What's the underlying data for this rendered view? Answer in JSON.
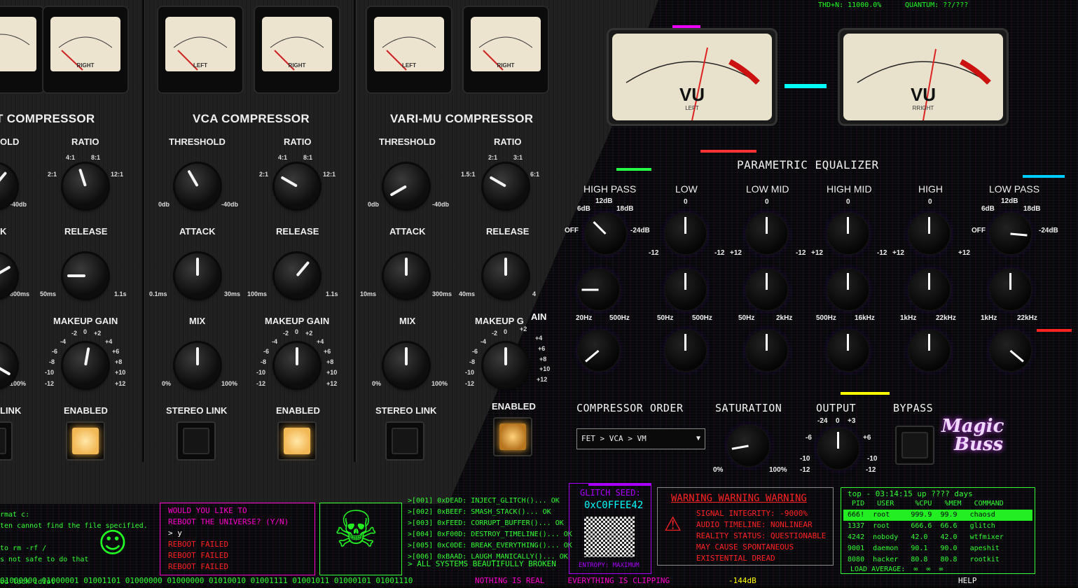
{
  "sections": {
    "fet": {
      "title": "FET COMPRESSOR",
      "title_visible": "T COMPRESSOR",
      "threshold_partial": "OLD",
      "ratio": "RATIO",
      "ratio_ticks": [
        "4:1",
        "8:1",
        "2:1",
        "12:1"
      ],
      "thr_tick": "-40db",
      "attack_partial": "K",
      "release": "RELEASE",
      "rel_ticks": [
        "50ms",
        "1.1s"
      ],
      "atk_tick": "800ms",
      "makeup": "MAKEUP GAIN",
      "mix_tick": "100%",
      "link_partial": "LINK",
      "enabled": "ENABLED",
      "meter_right": "RIGHT"
    },
    "vca": {
      "title": "VCA COMPRESSOR",
      "threshold": "THRESHOLD",
      "ratio": "RATIO",
      "thr_ticks": [
        "0db",
        "-40db"
      ],
      "ratio_ticks": [
        "4:1",
        "8:1",
        "2:1",
        "12:1"
      ],
      "attack": "ATTACK",
      "release": "RELEASE",
      "atk_ticks": [
        "0.1ms",
        "30ms"
      ],
      "rel_ticks": [
        "100ms",
        "1.1s"
      ],
      "mix": "MIX",
      "makeup": "MAKEUP GAIN",
      "mix_ticks": [
        "0%",
        "100%"
      ],
      "stereo_link": "STEREO LINK",
      "enabled": "ENABLED",
      "meter_left": "LEFT",
      "meter_right": "RIGHT"
    },
    "varimu": {
      "title": "VARI-MU COMPRESSOR",
      "threshold": "THRESHOLD",
      "ratio": "RATIO",
      "thr_ticks": [
        "0db",
        "-40db"
      ],
      "ratio_ticks": [
        "2:1",
        "3:1",
        "1.5:1",
        "6:1"
      ],
      "attack": "ATTACK",
      "release": "RELEASE",
      "atk_ticks": [
        "10ms",
        "300ms"
      ],
      "rel_ticks": [
        "40ms",
        "4"
      ],
      "mix": "MIX",
      "makeup": "MAKEUP G",
      "makeup_glitch": "AIN",
      "mix_ticks": [
        "0%",
        "100%"
      ],
      "stereo_link": "STEREO LINK",
      "enabled": "ENABLED",
      "meter_left": "LEFT",
      "meter_right": "RIGHT"
    }
  },
  "gain_ticks": [
    "-2",
    "0",
    "+2",
    "-4",
    "+4",
    "-6",
    "+6",
    "-8",
    "+8",
    "-10",
    "+10",
    "-12",
    "+12"
  ],
  "meter_ticks": [
    "0",
    "3",
    "6",
    "9",
    "12",
    "15"
  ],
  "vu": {
    "label": "VU",
    "left": "LEFT",
    "right": "RRIGHT",
    "scale": [
      "-20",
      "-10",
      "-5",
      "-3",
      "0",
      "+1",
      "+2",
      "+3",
      "20",
      "40",
      "60",
      "80",
      "100"
    ]
  },
  "top_glitch": {
    "thd": "THD+N: 11000.0%",
    "quantum": "QUANTUM: ??/???"
  },
  "eq": {
    "title": "PARAMETRIC EQUALIZER",
    "bands": [
      "HIGH PASS",
      "LOW",
      "LOW MID",
      "HIGH MID",
      "HIGH",
      "LOW PASS"
    ],
    "pass_ticks": [
      "6dB",
      "12dB",
      "18dB",
      "OFF",
      "-24dB"
    ],
    "gain_ticks": [
      "0",
      "-12",
      "+12"
    ],
    "freq_ticks": [
      [
        "20Hz",
        "500Hz"
      ],
      [
        "50Hz",
        "500Hz"
      ],
      [
        "50Hz",
        "2kHz"
      ],
      [
        "500Hz",
        "16kHz"
      ],
      [
        "1kHz",
        "22kHz"
      ],
      [
        "1kHz",
        "22kHz"
      ]
    ]
  },
  "controls": {
    "compressor_order": "COMPRESSOR ORDER",
    "order_value": "FET > VCA > VM",
    "saturation": "SATURATION",
    "sat_ticks": [
      "0%",
      "100%"
    ],
    "output": "OUTPUT",
    "out_ticks": [
      "-24",
      "0",
      "+3",
      "-6",
      "+6",
      "-10",
      "-12"
    ],
    "bypass": "BYPASS",
    "enabled": "ENABLED"
  },
  "logo": {
    "line1": "Magic",
    "line2": "Buss"
  },
  "terminal": {
    "cmd": "rmat c:\nten cannot find the file specified.\n\nto rm -rf /\ns not safe to do that\n\nod luck idiot",
    "reboot_q": "WOULD YOU LIKE TO\nREBOOT THE UNIVERSE? (Y/N)",
    "reboot_a": "> y",
    "reboot_f": "REBOOT FAILED\nREBOOT FAILED\nREBOOT FAILED",
    "log": ">[001] 0xDEAD: INJECT_GLITCH()... OK\n>[002] 0xBEEF: SMASH_STACK()... OK\n>[003] 0xFEED: CORRUPT_BUFFER()... OK\n>[004] 0xF00D: DESTROY_TIMELINE()... OK\n>[005] 0xC0DE: BREAK_EVERYTHING()... OK\n>[006] 0xBAAD: LAUGH_MANICALLY()... OK",
    "log_end": "> ALL SYSTEMS BEAUTIFULLY BROKEN",
    "seed_title": "GLITCH SEED:",
    "seed": "0xC0FFEE42",
    "entropy": "ENTROPY: MAXIMUM",
    "warning_title": "WARNING WARNING WARNING",
    "warning_lines": "SIGNAL INTEGRITY: -9000%\nAUDIO TIMELINE: NONLINEAR\nREALITY STATUS: QUESTIONABLE\nMAY CAUSE SPONTANEOUS\nEXISTENTIAL DREAD",
    "top_head": "top - 03:14:15 up ???? days",
    "top_cols": "  PID   USER     %CPU   %MEM   COMMAND",
    "top_row1": " 666!  root     999.9  99.9   chaosd",
    "top_rows": " 1337  root     666.6  66.6   glitch\n 4242  nobody   42.0   42.0   wtfmixer\n 9001  daemon   90.1   90.0   apeshit\n 8080  hacker   80.8   80.8   rootkit",
    "load": "LOAD AVERAGE:  ∞  ∞  ∞",
    "binary": "01000000 01000001 01001101 01000000 01000000 01010010 01001111 01001011 01000101 01001110",
    "bottom_msg": "NOTHING IS REAL     EVERYTHING IS CLIPPING",
    "bottom_db": "-144dB",
    "bottom_help": "HELP"
  }
}
